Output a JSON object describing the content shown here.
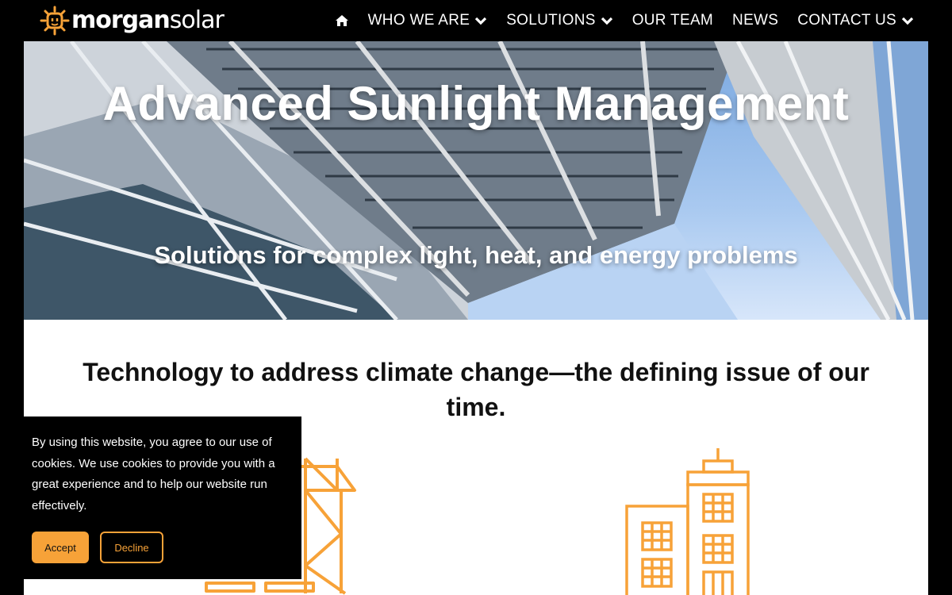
{
  "header": {
    "brand_bold": "morgan",
    "brand_light": "solar",
    "nav": [
      {
        "label": "WHO WE ARE",
        "dropdown": true
      },
      {
        "label": "SOLUTIONS",
        "dropdown": true
      },
      {
        "label": "OUR TEAM",
        "dropdown": false
      },
      {
        "label": "NEWS",
        "dropdown": false
      },
      {
        "label": "CONTACT US",
        "dropdown": true
      }
    ],
    "icons": {
      "home": "home-icon",
      "chevron": "chevron-down-icon",
      "logo": "sun-plug-icon"
    }
  },
  "hero": {
    "title": "Advanced Sunlight Management",
    "subtitle": "Solutions for complex light, heat, and energy problems"
  },
  "content": {
    "headline": "Technology to address climate change—the defining issue of our time.",
    "icons": [
      "power-tower-icon",
      "office-building-icon"
    ]
  },
  "cookie": {
    "text": "By using this website, you agree to our use of cookies. We use cookies to provide you with a great experience and to help our website run effectively.",
    "accept": "Accept",
    "decline": "Decline"
  },
  "colors": {
    "accent": "#f7a238",
    "header_bg": "#000000",
    "text_dark": "#111111"
  }
}
